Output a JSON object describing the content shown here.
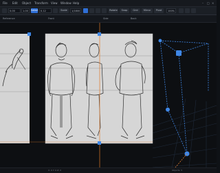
{
  "menubar": {
    "items": [
      "File",
      "Edit",
      "Object",
      "Transform",
      "View",
      "Window",
      "Help"
    ]
  },
  "toolbar": {
    "tool_labels": [
      "Select",
      "Scale",
      "Rotate",
      "Snap",
      "Grid",
      "Mirror",
      "Pivot"
    ],
    "field_a": "0.00",
    "field_b": "1.00",
    "field_c": "0.12",
    "field_d": "100%",
    "frame_value": "1/1800"
  },
  "strip": {
    "labels": [
      "Reference",
      "Front",
      "Side",
      "Back"
    ]
  },
  "status": {
    "left": "X: 0  Y: 0  Z: 0",
    "right": "Objects: 5"
  },
  "colors": {
    "accent": "#2f6fd6",
    "guide_orange": "#e07a2c",
    "guide_blue": "#3f87e6",
    "paper": "#d6d6d6"
  }
}
